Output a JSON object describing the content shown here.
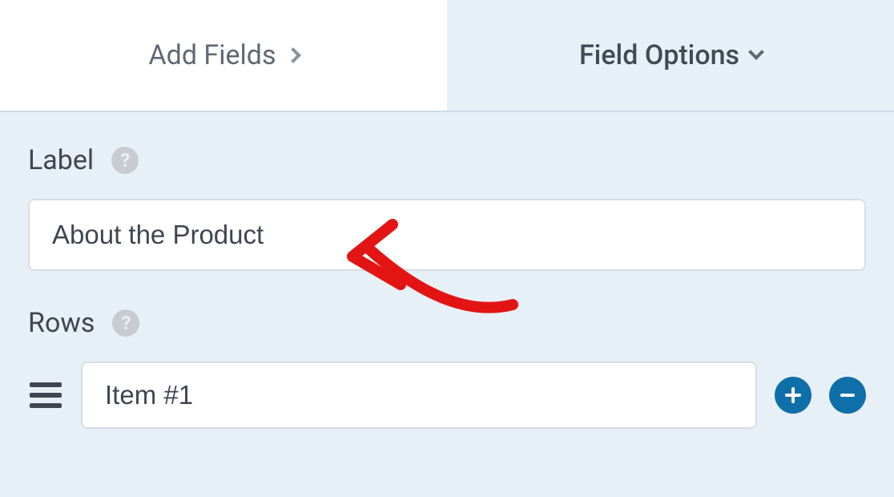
{
  "tabs": {
    "add_fields": "Add Fields",
    "field_options": "Field Options"
  },
  "form": {
    "label_section": {
      "title": "Label",
      "value": "About the Product"
    },
    "rows_section": {
      "title": "Rows",
      "rows": [
        {
          "value": "Item #1"
        }
      ]
    }
  },
  "icons": {
    "help": "?",
    "add": "+",
    "remove": "-"
  },
  "annotation": {
    "color": "#e31414"
  }
}
